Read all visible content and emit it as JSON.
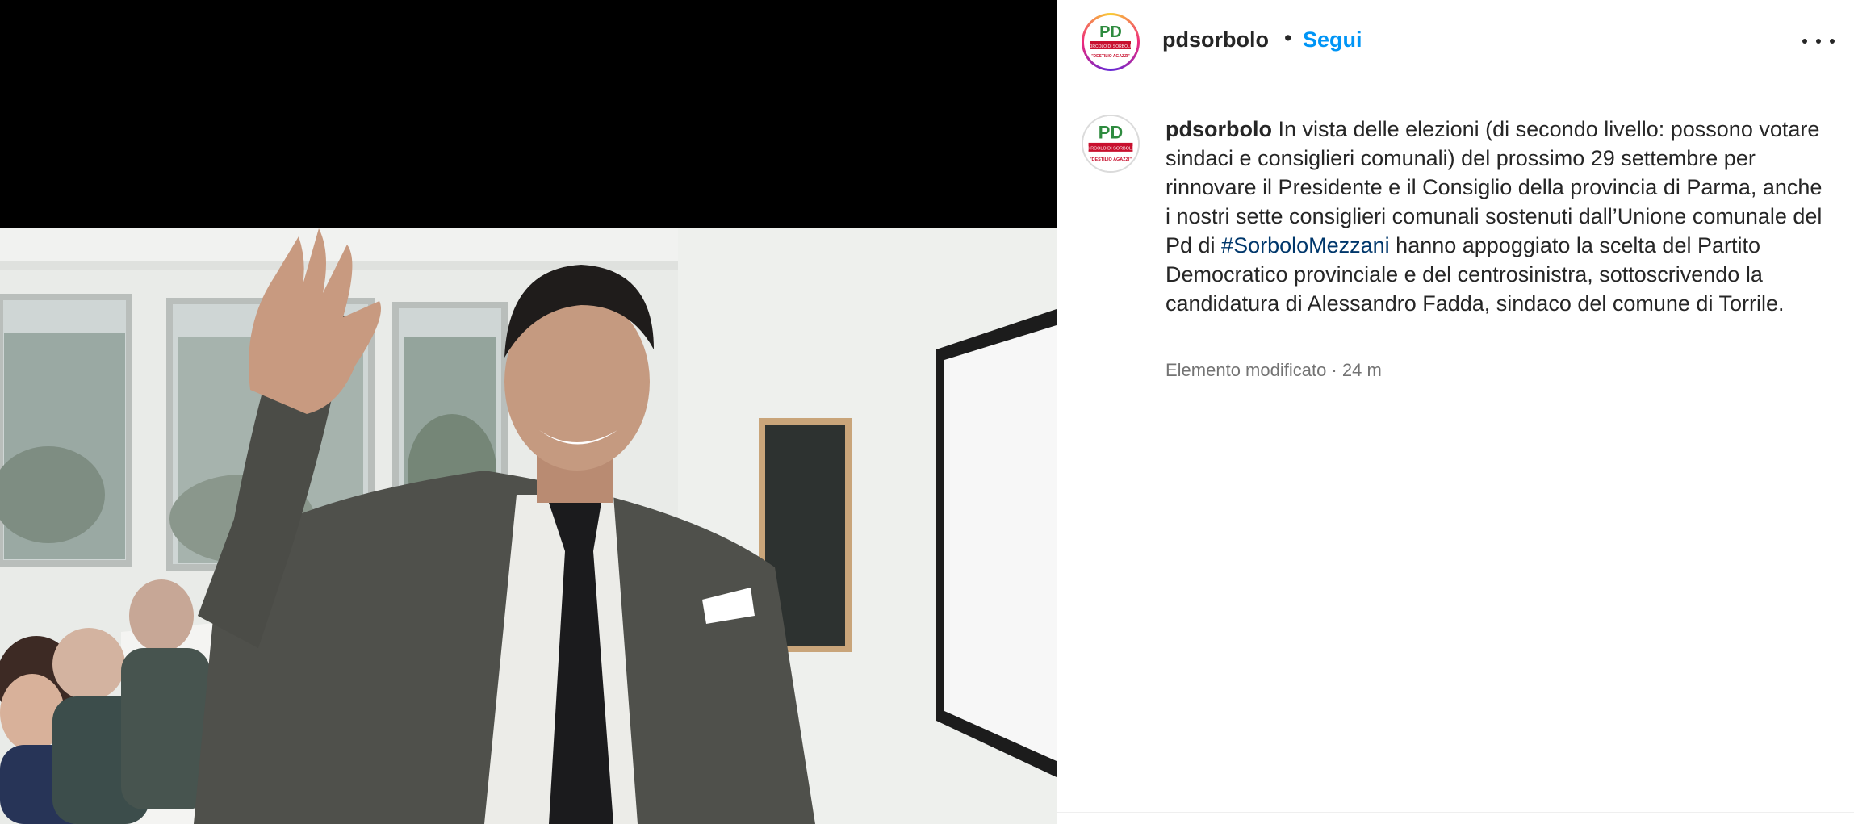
{
  "post": {
    "username": "pdsorbolo",
    "separator": "•",
    "follow_label": "Segui",
    "more_icon": "more-horizontal-icon"
  },
  "avatar": {
    "logo_text": "PD",
    "ribbon_text": "CIRCOLO DI SORBOLO",
    "name_text": "\"DESTILIO AGAZZI\""
  },
  "caption": {
    "username": "pdsorbolo",
    "text_before": "In vista delle elezioni (di secondo livello: possono votare sindaci e consiglieri comunali) del prossimo 29 settembre per rinnovare il Presidente e il Consiglio della provincia di Parma, anche i nostri sette consiglieri comunali sostenuti dall’Unione comunale del Pd di ",
    "hashtag": "#SorboloMezzani",
    "text_after": " hanno appoggiato la scelta del Partito Democratico provinciale e del centrosinistra, sottoscrivendo la candidatura di Alessandro Fadda, sindaco del comune di Torrile.",
    "edited_label": "Elemento modificato · 24 m"
  },
  "colors": {
    "follow_blue": "#0095f6",
    "hashtag_blue": "#00376b",
    "text": "#262626",
    "meta_gray": "#737373"
  }
}
